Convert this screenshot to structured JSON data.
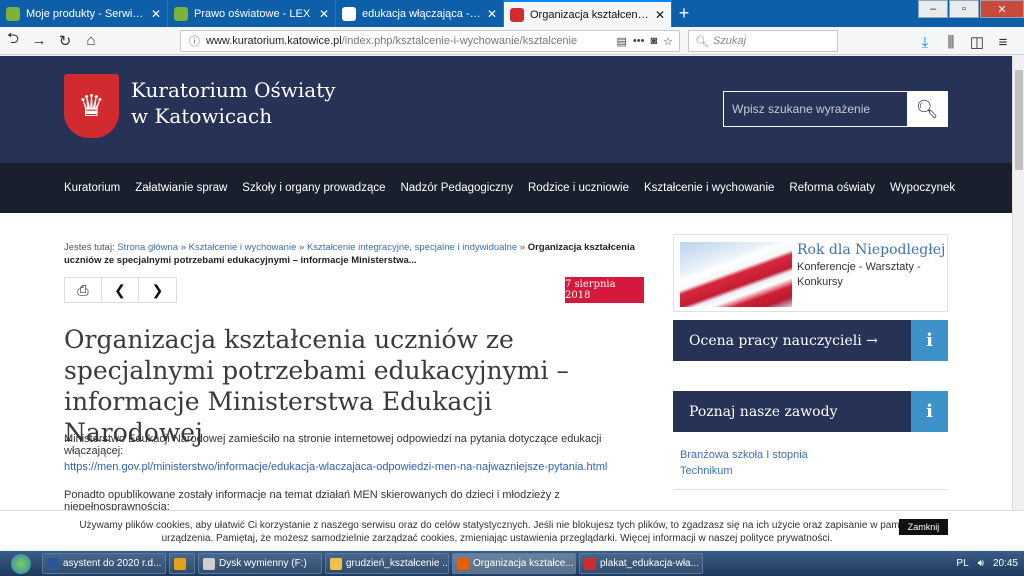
{
  "browser": {
    "tabs": [
      {
        "title": "Moje produkty - Serwis logowa",
        "color": "#7bb33a",
        "active": false
      },
      {
        "title": "Prawo oświatowe - LEX",
        "color": "#7bb33a",
        "active": false
      },
      {
        "title": "edukacja włączająca - Szukaj w",
        "color": "#ffffff",
        "active": false
      },
      {
        "title": "Organizacja kształcenia uczniów",
        "color": "#d12b2f",
        "active": true
      }
    ],
    "url_domain": "www.kuratorium.katowice.pl",
    "url_path": "/index.php/ksztalcenie-i-wychowanie/ksztalcenie",
    "search_placeholder": "Szukaj"
  },
  "site": {
    "name_line1": "Kuratorium Oświaty",
    "name_line2": "w Katowicach",
    "search_placeholder": "Wpisz szukane wyrażenie",
    "menu": [
      "Kuratorium",
      "Załatwianie spraw",
      "Szkoły i organy prowadzące",
      "Nadzór Pedagogiczny",
      "Rodzice i uczniowie",
      "Kształcenie i wychowanie",
      "Reforma oświaty",
      "Wypoczynek"
    ]
  },
  "breadcrumb": {
    "prefix": "Jesteś tutaj: ",
    "links": [
      "Strona główna",
      "Kształcenie i wychowanie",
      "Kształcenie integracyjne, specjalne i indywidualne"
    ],
    "sep": " » ",
    "current": "Organizacja kształcenia uczniów ze specjalnymi potrzebami edukacyjnymi – informacje Ministerstwa..."
  },
  "article": {
    "date": "7 sierpnia 2018",
    "title": "Organizacja kształcenia uczniów ze specjalnymi potrzebami edukacyjnymi – informacje Ministerstwa Edukacji Narodowej",
    "p1": "Ministerstwo Edukacji Narodowej zamieściło na stronie internetowej odpowiedzi na pytania dotyczące edukacji włączającej:",
    "link": "https://men.gov.pl/ministerstwo/informacje/edukacja-wlaczajaca-odpowiedzi-men-na-najwazniejsze-pytania.html",
    "p2": "Ponadto opublikowane zostały informacje na temat działań MEN skierowanych do dzieci i młodzieży z niepełnosprawnością:"
  },
  "sidebar": {
    "promo_title": "Rok dla Niepodległej",
    "promo_text": "Konferencje - Warsztaty - Konkursy",
    "panel1": "Ocena pracy nauczycieli →",
    "panel2": "Poznaj nasze zawody",
    "info_glyph": "i",
    "links": [
      "Branżowa szkoła I stopnia",
      "Technikum"
    ]
  },
  "cookie": {
    "text": "Używamy plików cookies, aby ułatwić Ci korzystanie z naszego serwisu oraz do celów statystycznych. Jeśli nie blokujesz tych plików, to zgadzasz się na ich użycie oraz zapisanie w pamięci urządzenia. Pamiętaj, że możesz samodzielnie zarządzać cookies, zmieniając ustawienia przeglądarki. Więcej informacji w naszej polityce prywatności.",
    "button": "Zamknij"
  },
  "taskbar": {
    "items": [
      {
        "label": "asystent do 2020 r.d...",
        "color": "#2b5797",
        "active": false
      },
      {
        "label": "",
        "color": "#e2a21b",
        "active": false
      },
      {
        "label": "Dysk wymienny (F:)",
        "color": "#cfcfcf",
        "active": false
      },
      {
        "label": "grudzień_kształcenie ...",
        "color": "#f0c14b",
        "active": false
      },
      {
        "label": "Organizacja kształce...",
        "color": "#e66000",
        "active": true
      },
      {
        "label": "plakat_edukacja-wła...",
        "color": "#d12b2f",
        "active": false
      }
    ],
    "lang": "PL",
    "time": "20:45"
  }
}
